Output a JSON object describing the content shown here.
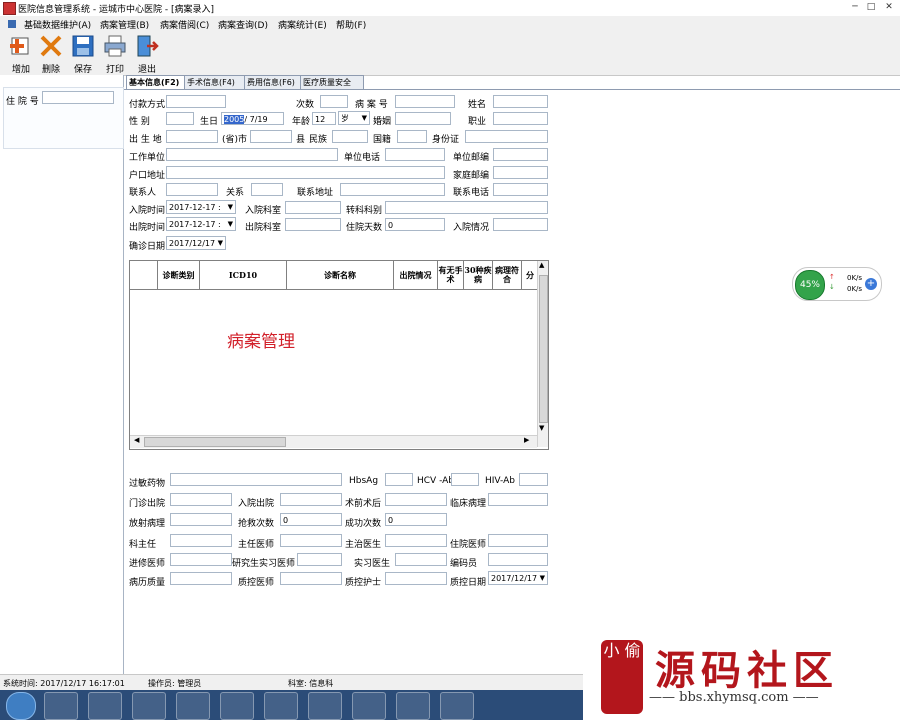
{
  "window": {
    "title": "医院信息管理系统  -  运城市中心医院 - [病案录入]",
    "btn_min": "─",
    "btn_max": "□",
    "btn_close": "✕"
  },
  "menu": [
    "基础数据维护(A)",
    "病案管理(B)",
    "病案借阅(C)",
    "病案查询(D)",
    "病案统计(E)",
    "帮助(F)"
  ],
  "toolbar": {
    "add": "增加",
    "delete": "删除",
    "save": "保存",
    "print": "打印",
    "exit": "退出"
  },
  "left": {
    "label": "住 院 号",
    "value": ""
  },
  "tabs": [
    "基本信息(F2)",
    "手术信息(F4)",
    "费用信息(F6)",
    "医疗质量安全"
  ],
  "form": {
    "row1": [
      "付款方式",
      "次数",
      "病 案 号",
      "姓名"
    ],
    "row2": [
      "性  别",
      "生日",
      "年龄",
      "婚姻",
      "职业"
    ],
    "birthday": {
      "sel": "2005",
      "rest": "/ 7/19"
    },
    "age": "12",
    "age_unit": "岁",
    "row3": [
      "出 生 地",
      "(省)市",
      "县",
      "民族",
      "国籍",
      "身份证"
    ],
    "row4": [
      "工作单位",
      "单位电话",
      "单位邮编"
    ],
    "row5": [
      "户口地址",
      "家庭邮编"
    ],
    "row6": [
      "联系人",
      "关系",
      "联系地址",
      "联系电话"
    ],
    "row7": [
      "入院时间",
      "入院科室",
      "转科科别"
    ],
    "admit_date": "2017-12-17  :",
    "row8": [
      "出院时间",
      "出院科室",
      "住院天数",
      "入院情况"
    ],
    "discharge_date": "2017-12-17  :",
    "days": "0",
    "row9": [
      "确诊日期"
    ],
    "confirm_date": "2017/12/17"
  },
  "grid": {
    "headers": [
      "诊断类别",
      "ICD10",
      "诊断名称",
      "出院情况",
      "有无手术",
      "30种疾病",
      "病理符合",
      "分"
    ]
  },
  "mid_text": "病案管理",
  "bottom": {
    "row1": [
      "过敏药物",
      "HbsAg",
      "HCV -Ab",
      "HIV-Ab"
    ],
    "row2": [
      "门诊出院",
      "入院出院",
      "术前术后",
      "临床病理"
    ],
    "row3": [
      "放射病理",
      "抢救次数",
      "成功次数"
    ],
    "rescue": "0",
    "success": "0",
    "row4": [
      "科主任",
      "主任医师",
      "主治医生",
      "住院医师"
    ],
    "row5": [
      "进修医师",
      "研究生实习医师",
      "实习医生",
      "编码员"
    ],
    "row6": [
      "病历质量",
      "质控医师",
      "质控护士",
      "质控日期"
    ],
    "qc_date": "2017/12/17"
  },
  "status": {
    "time": "系统时间: 2017/12/17  16:17:01",
    "operator": "操作员: 管理员",
    "dept": "科室: 信息科"
  },
  "net": {
    "pct": "45%",
    "up": "0K/s",
    "down": "0K/s"
  },
  "brand": {
    "seal": "小\n偷",
    "big": "源码社区",
    "url": "—— bbs.xhymsq.com ——"
  }
}
